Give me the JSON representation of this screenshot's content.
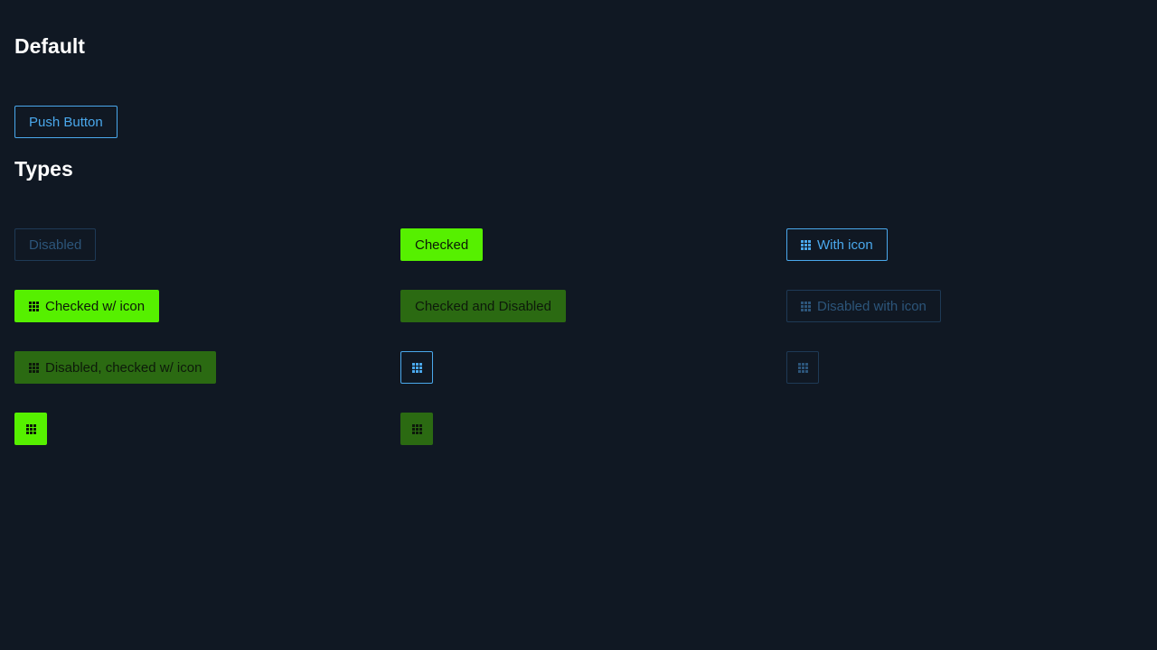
{
  "sections": {
    "default_title": "Default",
    "types_title": "Types"
  },
  "buttons": {
    "push": "Push Button",
    "disabled": "Disabled",
    "checked": "Checked",
    "with_icon": "With icon",
    "checked_with_icon": "Checked w/ icon",
    "checked_and_disabled": "Checked and Disabled",
    "disabled_with_icon": "Disabled with icon",
    "disabled_checked_with_icon": "Disabled, checked w/ icon"
  },
  "icons": {
    "grid": "apps-grid-icon"
  },
  "colors": {
    "background": "#101823",
    "primary": "#4aa8ec",
    "checked": "#56f000",
    "checked_disabled": "#2b6a12",
    "disabled_border": "#1e3a56"
  }
}
